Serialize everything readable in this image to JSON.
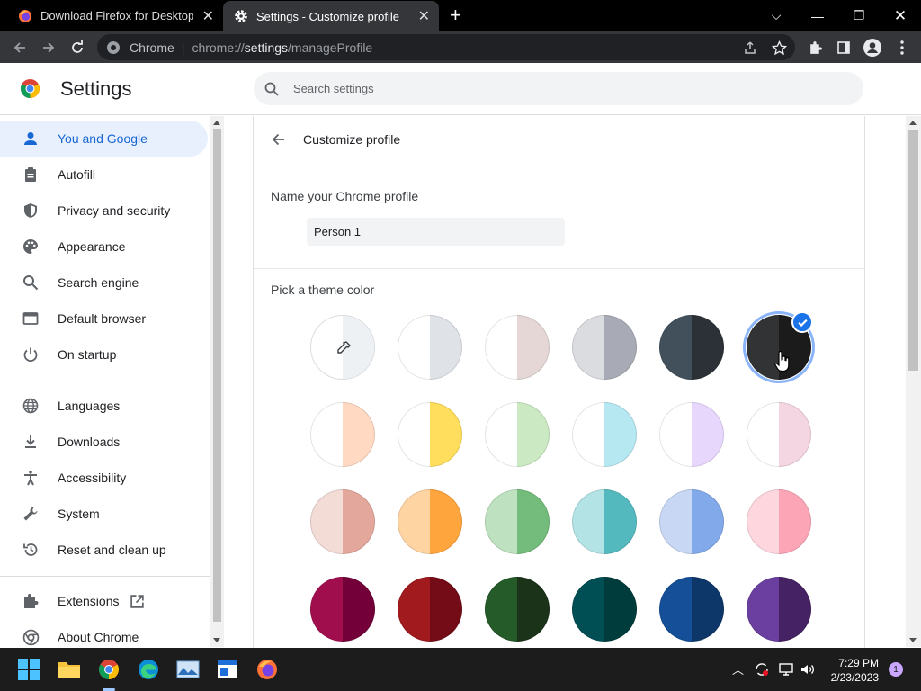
{
  "tabs": [
    {
      "title": "Download Firefox for Desktop —",
      "active": false
    },
    {
      "title": "Settings - Customize profile",
      "active": true
    }
  ],
  "omnibox": {
    "site": "Chrome",
    "url_prefix": "chrome://",
    "url_bold": "settings",
    "url_suffix": "/manageProfile"
  },
  "header": {
    "title": "Settings",
    "search_placeholder": "Search settings"
  },
  "sidebar": {
    "items": [
      {
        "label": "You and Google",
        "icon": "person-icon",
        "active": true
      },
      {
        "label": "Autofill",
        "icon": "clipboard-icon"
      },
      {
        "label": "Privacy and security",
        "icon": "shield-icon"
      },
      {
        "label": "Appearance",
        "icon": "palette-icon"
      },
      {
        "label": "Search engine",
        "icon": "search-icon"
      },
      {
        "label": "Default browser",
        "icon": "browser-icon"
      },
      {
        "label": "On startup",
        "icon": "power-icon"
      },
      {
        "label": "Languages",
        "icon": "globe-icon"
      },
      {
        "label": "Downloads",
        "icon": "download-icon"
      },
      {
        "label": "Accessibility",
        "icon": "accessibility-icon"
      },
      {
        "label": "System",
        "icon": "wrench-icon"
      },
      {
        "label": "Reset and clean up",
        "icon": "reset-icon"
      },
      {
        "label": "Extensions",
        "icon": "puzzle-icon"
      },
      {
        "label": "About Chrome",
        "icon": "chrome-icon"
      }
    ]
  },
  "profile": {
    "page_title": "Customize profile",
    "name_label": "Name your Chrome profile",
    "name_value": "Person 1",
    "theme_label": "Pick a theme color"
  },
  "colors": {
    "accent": "#1a73e8",
    "active_nav_bg": "#e8f0fe",
    "swatches": [
      [
        "picker",
        "#e3e5e8",
        "#d7dadf",
        "#a8abb5",
        "#42505b",
        "#323334"
      ],
      [
        "#ffddc8",
        "#fed94f",
        "#cbe9c2",
        "#b6e8f2",
        "#e8d7fd",
        "#f4d5e2"
      ],
      [
        "#e4a79b",
        "#ffa53d",
        "#73bc7c",
        "#54b9bf",
        "#82a9ea",
        "#fba5b6"
      ],
      [
        "#730039",
        "#730c16",
        "#1a3319",
        "#003c3c",
        "#0e3769",
        "#452263"
      ]
    ],
    "swatch_left": [
      [
        "#ffffff",
        "#ffffff",
        "#ffffff",
        "#dadcdf",
        "#42505b",
        "#323334"
      ],
      [
        "#ffffff",
        "#ffffff",
        "#ffffff",
        "#ffffff",
        "#ffffff",
        "#ffffff"
      ],
      [
        "#f3dbd6",
        "#ffd4a3",
        "#bee2c0",
        "#b3e3e5",
        "#c8d8f4",
        "#fed7de"
      ],
      [
        "#a10e4e",
        "#a01a1e",
        "#255a29",
        "#004f54",
        "#144f97",
        "#6a3fa0"
      ]
    ],
    "swatch_right": [
      [
        "#eef1f4",
        "#dfe3e8",
        "#e4d7d5",
        "#a8abb5",
        "#2b3136",
        "#1b1b1c"
      ],
      [
        "#ffd9c2",
        "#fede5c",
        "#cbe9c2",
        "#b6e8f2",
        "#e8d7fd",
        "#f4d5e2"
      ],
      [
        "#e4a79b",
        "#ffa53d",
        "#73bc7c",
        "#54b9bf",
        "#82a9ea",
        "#fba5b6"
      ],
      [
        "#730039",
        "#730c16",
        "#1a3319",
        "#003c3c",
        "#0e3769",
        "#452263"
      ]
    ],
    "selected": [
      0,
      5
    ]
  },
  "taskbar": {
    "time": "7:29 PM",
    "date": "2/23/2023",
    "notifications": "1"
  }
}
